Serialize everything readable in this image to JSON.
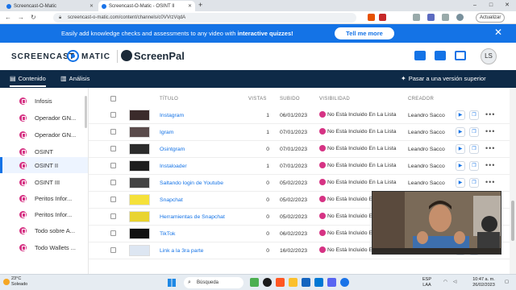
{
  "browser": {
    "tabs": [
      {
        "label": "Screencast-O-Matic"
      },
      {
        "label": "Screencast-O-Matic - OSINT II"
      }
    ],
    "url": "screencast-o-matic.com/content/channels/c0VVrzVqdA",
    "update_label": "Actualizar"
  },
  "banner": {
    "text_before": "Easily add knowledge checks and assessments to any video with ",
    "text_bold": "interactive quizzes!",
    "cta": "Tell me more"
  },
  "header": {
    "logo_text_a": "SCREENCAST",
    "logo_text_b": "MATIC",
    "brand2": "ScreenPal",
    "avatar_initials": "LS"
  },
  "nav": {
    "content": "Contenido",
    "analysis": "Análisis",
    "upgrade": "Pasar a una versión superior"
  },
  "sidebar": {
    "items": [
      {
        "label": "Infosis"
      },
      {
        "label": "Operador GN..."
      },
      {
        "label": "Operador GN..."
      },
      {
        "label": "OSINT"
      },
      {
        "label": "OSINT II"
      },
      {
        "label": "OSINT III"
      },
      {
        "label": "Peritos Infor..."
      },
      {
        "label": "Peritos Infor..."
      },
      {
        "label": "Todo sobre A..."
      },
      {
        "label": "Todo Wallets ..."
      }
    ]
  },
  "table": {
    "headers": {
      "title": "TÍTULO",
      "views": "VISTAS",
      "uploaded": "SUBIDO",
      "visibility": "VISIBILIDAD",
      "creator": "CREADOR"
    },
    "rows": [
      {
        "title": "Instagram",
        "views": "1",
        "date": "06/01/2023",
        "visibility": "No Está Incluido En La Lista",
        "creator": "Leandro Sacco"
      },
      {
        "title": "Igram",
        "views": "1",
        "date": "07/01/2023",
        "visibility": "No Está Incluido En La Lista",
        "creator": "Leandro Sacco"
      },
      {
        "title": "Osintgram",
        "views": "0",
        "date": "07/01/2023",
        "visibility": "No Está Incluido En La Lista",
        "creator": "Leandro Sacco"
      },
      {
        "title": "Instaloader",
        "views": "1",
        "date": "07/01/2023",
        "visibility": "No Está Incluido En La Lista",
        "creator": "Leandro Sacco"
      },
      {
        "title": "Saltando login de Youtube",
        "views": "0",
        "date": "05/02/2023",
        "visibility": "No Está Incluido En La Lista",
        "creator": "Leandro Sacco"
      },
      {
        "title": "Snapchat",
        "views": "0",
        "date": "05/02/2023",
        "visibility": "No Está Incluido En La Lista",
        "creator": ""
      },
      {
        "title": "Herramientas de Snapchat",
        "views": "0",
        "date": "05/02/2023",
        "visibility": "No Está Incluido En La Lista",
        "creator": ""
      },
      {
        "title": "TikTok",
        "views": "0",
        "date": "06/02/2023",
        "visibility": "No Está Incluido En La Lista",
        "creator": ""
      },
      {
        "title": "Link a la 3ra parte",
        "views": "0",
        "date": "16/02/2023",
        "visibility": "No Está Incluido En La Lista",
        "creator": ""
      }
    ]
  },
  "taskbar": {
    "temp": "23°C",
    "weather": "Soleado",
    "search": "Búsqueda",
    "lang1": "ESP",
    "lang2": "LAA",
    "time": "10:47 a. m.",
    "date": "26/02/2023"
  }
}
